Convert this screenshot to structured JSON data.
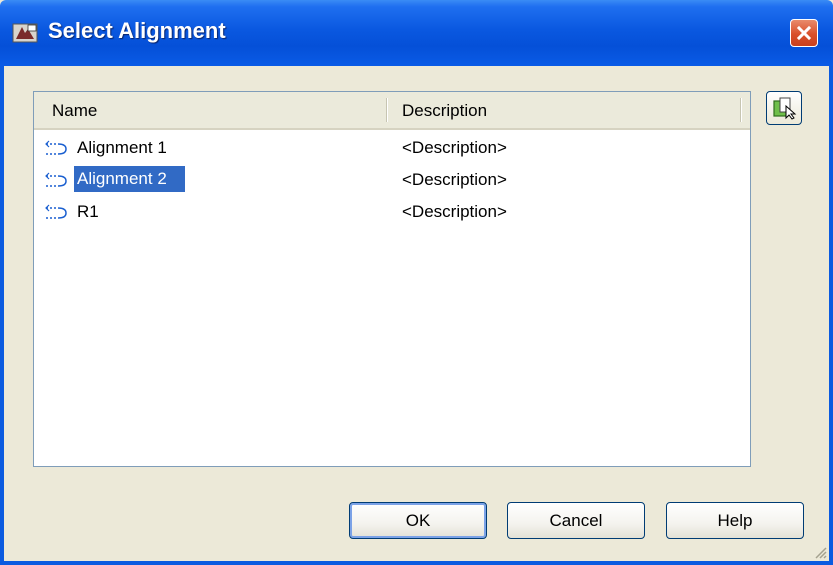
{
  "window": {
    "title": "Select Alignment"
  },
  "list": {
    "columns": [
      "Name",
      "Description"
    ],
    "rows": [
      {
        "name": "Alignment 1",
        "description": "<Description>",
        "selected": false
      },
      {
        "name": "Alignment 2",
        "description": "<Description>",
        "selected": true
      },
      {
        "name": "R1",
        "description": "<Description>",
        "selected": false
      }
    ]
  },
  "buttons": {
    "ok": "OK",
    "cancel": "Cancel",
    "help": "Help"
  },
  "icons": {
    "app": "app-icon",
    "close": "close-icon",
    "pick": "pick-from-drawing-icon",
    "row": "alignment-icon"
  },
  "colors": {
    "title_bar": "#0a58e0",
    "selection": "#316ac5",
    "close": "#d9502b"
  }
}
